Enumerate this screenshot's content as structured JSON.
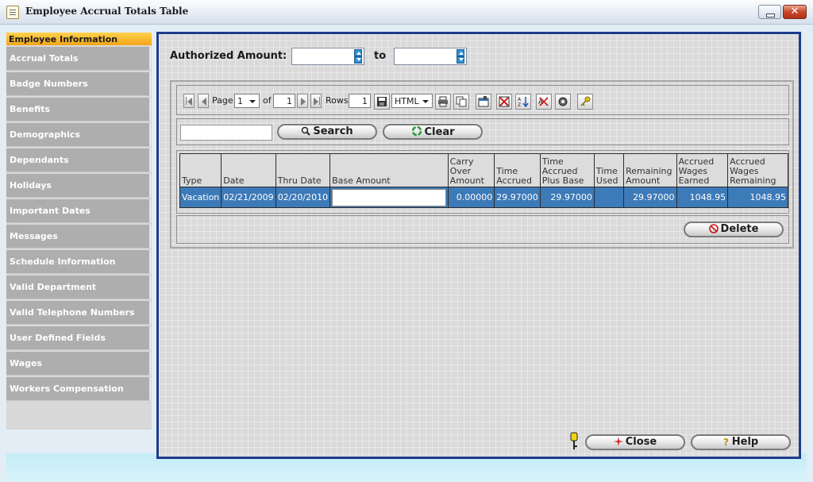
{
  "window": {
    "title": "Employee Accrual Totals Table"
  },
  "sidebar": {
    "header": "Employee Information",
    "items": [
      "Accrual Totals",
      "Badge Numbers",
      "Benefits",
      "Demographics",
      "Dependants",
      "Holidays",
      "Important Dates",
      "Messages",
      "Schedule Information",
      "Valid Department",
      "Valid Telephone Numbers",
      "User Defined Fields",
      "Wages",
      "Workers Compensation"
    ]
  },
  "filter": {
    "label": "Authorized Amount:",
    "to_label": "to",
    "from_value": "",
    "to_value": ""
  },
  "toolbar": {
    "page_label": "Page",
    "page_value": "1",
    "of_label": "of",
    "of_value": "1",
    "rows_label": "Rows",
    "rows_value": "1",
    "format_value": "HTML"
  },
  "search": {
    "value": "",
    "search_label": "Search",
    "clear_label": "Clear"
  },
  "table": {
    "headers": [
      "Type",
      "Date",
      "Thru Date",
      "Base Amount",
      "Carry Over Amount",
      "Time Accrued",
      "Time Accrued Plus Base",
      "Time Used",
      "Remaining Amount",
      "Accrued Wages Earned",
      "Accrued Wages Remaining"
    ],
    "row": {
      "type": "Vacation",
      "date": "02/21/2009",
      "thru_date": "02/20/2010",
      "base_amount": "",
      "carry_over": "0.00000",
      "time_accrued": "29.97000",
      "time_accrued_plus_base": "29.97000",
      "time_used": "",
      "remaining": "29.97000",
      "wages_earned": "1048.95",
      "wages_remaining": "1048.95"
    }
  },
  "actions": {
    "delete_label": "Delete",
    "close_label": "Close",
    "help_label": "Help"
  },
  "colors": {
    "accent": "#1e3b8a",
    "selected_row": "#3d7ab8",
    "sidebar_header": "#f3a51a"
  }
}
